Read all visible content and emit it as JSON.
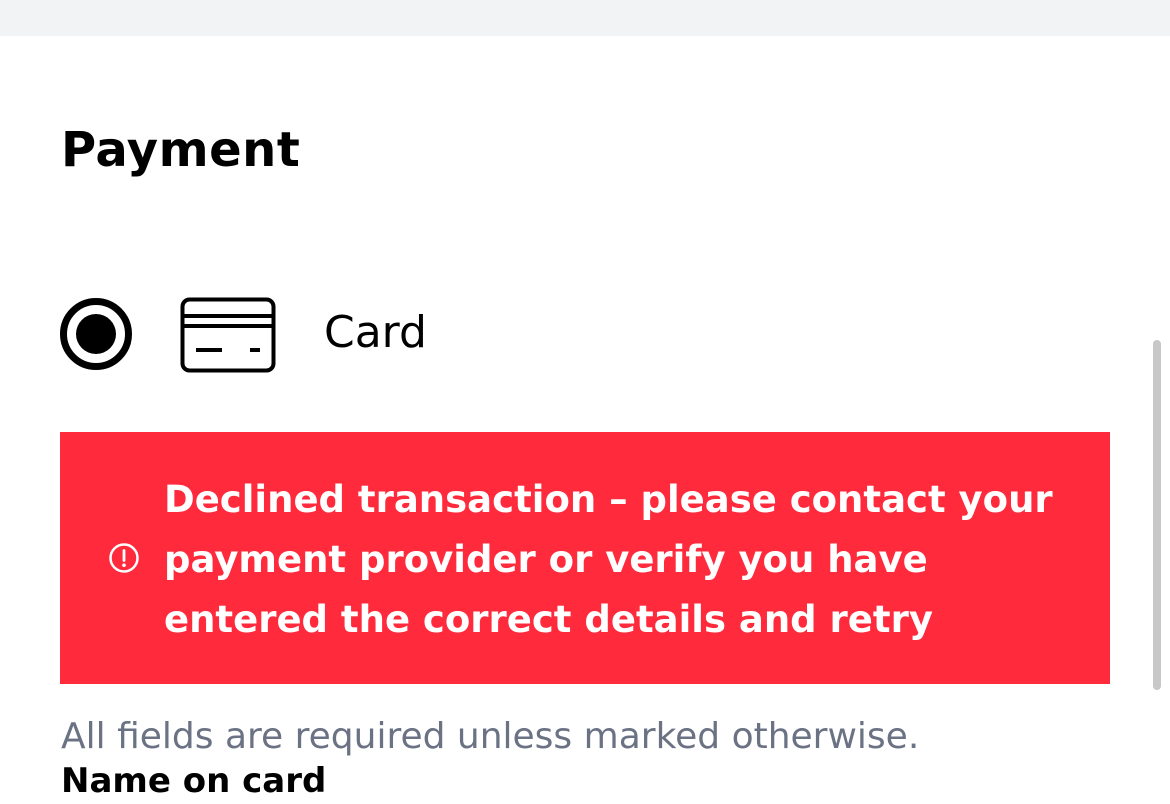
{
  "payment": {
    "title": "Payment",
    "method": {
      "label": "Card",
      "selected": true,
      "radio_icon": "radio-selected-icon",
      "icon": "credit-card-icon"
    },
    "error": {
      "icon": "alert-circle-icon",
      "message": "Declined transaction – please contact your payment provider or verify you have entered the correct details and retry",
      "background_color": "#ff2a3c",
      "text_color": "#ffffff"
    },
    "required_note": "All fields are required unless marked otherwise.",
    "name_on_card_label": "Name on card"
  }
}
